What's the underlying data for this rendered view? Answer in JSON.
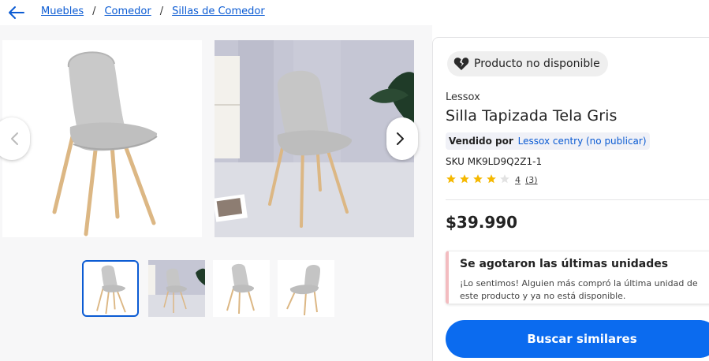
{
  "breadcrumb": {
    "items": [
      "Muebles",
      "Comedor",
      "Sillas de Comedor"
    ],
    "separator": "/"
  },
  "product": {
    "status_badge": "Producto no disponible",
    "brand": "Lessox",
    "title": "Silla Tapizada Tela Gris",
    "seller_prefix": "Vendido por",
    "seller_name": "Lessox centry (no publicar)",
    "sku": "SKU MK9LD9Q2Z1-1",
    "rating": {
      "value": 4,
      "max": 5,
      "rating_label": "4",
      "reviews_label": "(3)"
    },
    "price": "$39.990"
  },
  "alert": {
    "title": "Se agotaron las últimas unidades",
    "line1": "¡Lo sentimos! Alguien más compró la última unidad de",
    "line2": "este producto y ya no está disponible."
  },
  "cta": {
    "label": "Buscar similares"
  },
  "gallery": {
    "thumbnail_count": 4,
    "selected_thumbnail": 1
  },
  "colors": {
    "accent": "#0b6bef",
    "link": "#0b5bd3",
    "star": "#f5b800",
    "alert_border": "#f3bcc0"
  },
  "icons": [
    "back-arrow-icon",
    "chevron-left-icon",
    "chevron-right-icon",
    "broken-heart-icon",
    "star-icon"
  ]
}
